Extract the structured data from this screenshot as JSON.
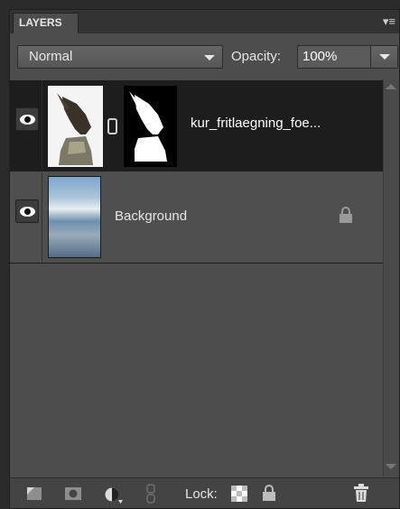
{
  "panel": {
    "title": "LAYERS",
    "menu_icon": "panel-menu-icon"
  },
  "toolbar": {
    "blend_mode": "Normal",
    "opacity_label": "Opacity:",
    "opacity_value": "100%"
  },
  "layers": [
    {
      "name": "kur_fritlaegning_foe...",
      "visible": true,
      "selected": true,
      "has_mask": true,
      "locked": false
    },
    {
      "name": "Background",
      "visible": true,
      "selected": false,
      "has_mask": false,
      "locked": true
    }
  ],
  "footer": {
    "lock_label": "Lock:",
    "icons": [
      "new-layer-icon",
      "add-mask-icon",
      "adjustment-layer-icon",
      "link-layers-icon",
      "lock-transparent-icon",
      "lock-all-icon",
      "delete-layer-icon"
    ]
  },
  "colors": {
    "panel_bg": "#4d4d4d",
    "selected_row_bg": "#1d1d1d",
    "text": "#e6e6e6"
  }
}
